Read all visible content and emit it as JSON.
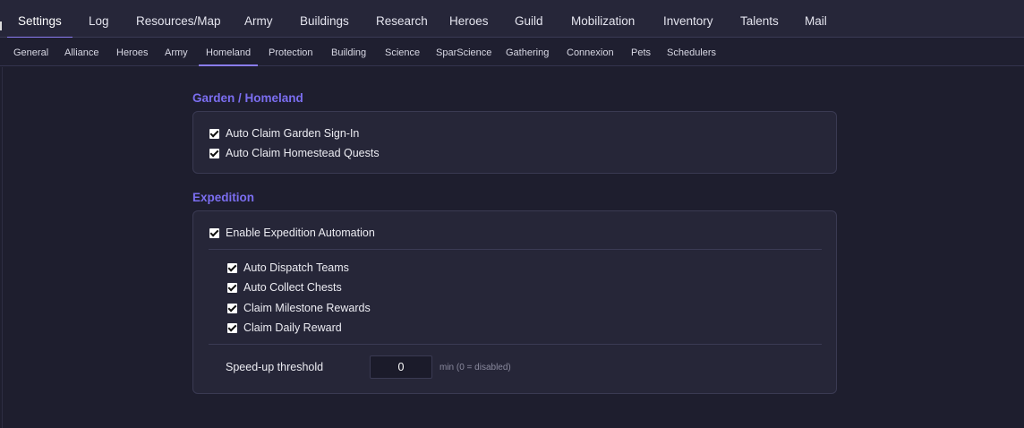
{
  "top_tabs": [
    "Settings",
    "Log",
    "Resources/Map",
    "Army",
    "Buildings",
    "Research",
    "Heroes",
    "Guild",
    "Mobilization",
    "Inventory",
    "Talents",
    "Mail"
  ],
  "sub_tabs": [
    "General",
    "Alliance",
    "Heroes",
    "Army",
    "Homeland",
    "Protection",
    "Building",
    "Science",
    "SparScience",
    "Gathering",
    "Connexion",
    "Pets",
    "Schedulers"
  ],
  "active_top_tab": "Settings",
  "active_sub_tab": "Homeland",
  "garden": {
    "title": "Garden / Homeland",
    "options": [
      {
        "label": "Auto Claim Garden Sign-In",
        "checked": true
      },
      {
        "label": "Auto Claim Homestead Quests",
        "checked": true
      }
    ]
  },
  "expedition": {
    "title": "Expedition",
    "enable": {
      "label": "Enable Expedition Automation",
      "checked": true
    },
    "options": [
      {
        "label": "Auto Dispatch Teams",
        "checked": true
      },
      {
        "label": "Auto Collect Chests",
        "checked": true
      },
      {
        "label": "Claim Milestone Rewards",
        "checked": true
      },
      {
        "label": "Claim Daily Reward",
        "checked": true
      }
    ],
    "speedup_label": "Speed-up threshold",
    "speedup_value": "0",
    "speedup_hint": "min (0 = disabled)"
  },
  "colors": {
    "accent": "#7b6ef0",
    "background": "#1e1e2e",
    "card": "#262638"
  }
}
